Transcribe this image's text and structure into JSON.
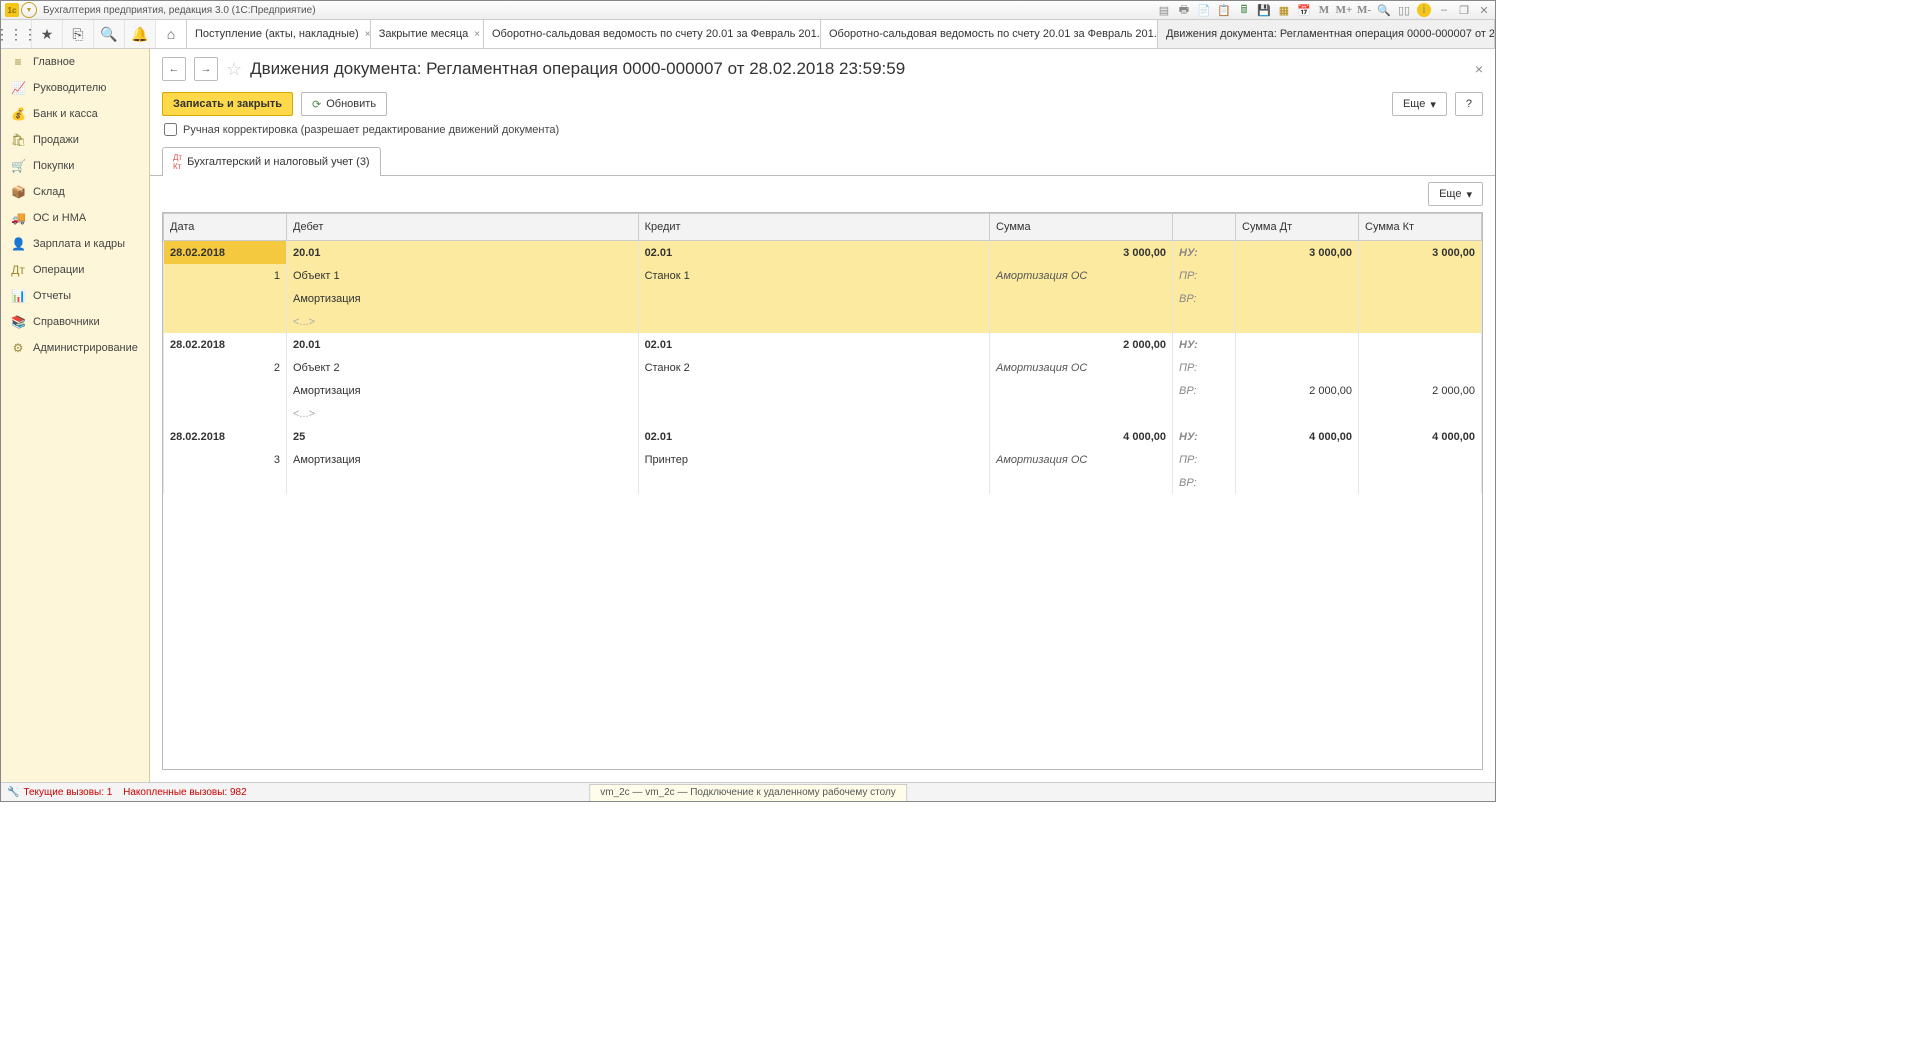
{
  "title": "Бухгалтерия предприятия, редакция 3.0  (1С:Предприятие)",
  "topTools": [
    "☰",
    "★",
    "⎘",
    "🔍",
    "🔔"
  ],
  "tabs": [
    {
      "label": "Поступление (акты, накладные)"
    },
    {
      "label": "Закрытие месяца"
    },
    {
      "label": "Оборотно-сальдовая ведомость по счету 20.01 за Февраль 201..."
    },
    {
      "label": "Оборотно-сальдовая ведомость по счету 20.01 за Февраль 201..."
    },
    {
      "label": "Движения документа: Регламентная операция 0000-000007 от 2...",
      "active": true
    }
  ],
  "sidebar": [
    {
      "ico": "≡",
      "label": "Главное"
    },
    {
      "ico": "📈",
      "label": "Руководителю"
    },
    {
      "ico": "💰",
      "label": "Банк и касса"
    },
    {
      "ico": "🛍",
      "label": "Продажи"
    },
    {
      "ico": "🛒",
      "label": "Покупки"
    },
    {
      "ico": "📦",
      "label": "Склад"
    },
    {
      "ico": "🚚",
      "label": "ОС и НМА"
    },
    {
      "ico": "👤",
      "label": "Зарплата и кадры"
    },
    {
      "ico": "Дт",
      "label": "Операции"
    },
    {
      "ico": "📊",
      "label": "Отчеты"
    },
    {
      "ico": "📚",
      "label": "Справочники"
    },
    {
      "ico": "⚙",
      "label": "Администрирование"
    }
  ],
  "pageTitle": "Движения документа: Регламентная операция 0000-000007 от 28.02.2018 23:59:59",
  "buttons": {
    "save": "Записать и закрыть",
    "refresh": "Обновить",
    "more": "Еще",
    "help": "?"
  },
  "checkbox": "Ручная корректировка (разрешает редактирование движений документа)",
  "subtab": "Бухгалтерский и налоговый учет (3)",
  "columns": {
    "date": "Дата",
    "debit": "Дебет",
    "credit": "Кредит",
    "sum": "Сумма",
    "sumDt": "Сумма Дт",
    "sumKt": "Сумма Кт"
  },
  "labels": {
    "nu": "НУ:",
    "pr": "ПР:",
    "vr": "ВР:",
    "placeholder": "<...>"
  },
  "rows": [
    {
      "sel": true,
      "n": "1",
      "date": "28.02.2018",
      "debit": "20.01",
      "credit": "02.01",
      "sum": "3 000,00",
      "sumDt": "3 000,00",
      "sumKt": "3 000,00",
      "l2d": "Объект 1",
      "l2c": "Станок 1",
      "l2s": "Амортизация ОС",
      "l3d": "Амортизация",
      "vrDt": "",
      "vrKt": ""
    },
    {
      "n": "2",
      "date": "28.02.2018",
      "debit": "20.01",
      "credit": "02.01",
      "sum": "2 000,00",
      "sumDt": "",
      "sumKt": "",
      "l2d": "Объект 2",
      "l2c": "Станок 2",
      "l2s": "Амортизация ОС",
      "l3d": "Амортизация",
      "vrDt": "2 000,00",
      "vrKt": "2 000,00"
    },
    {
      "n": "3",
      "date": "28.02.2018",
      "debit": "25",
      "credit": "02.01",
      "sum": "4 000,00",
      "sumDt": "4 000,00",
      "sumKt": "4 000,00",
      "l2d": "Амортизация",
      "l2c": "Принтер",
      "l2s": "Амортизация ОС",
      "l3d": "",
      "vrDt": "",
      "vrKt": "",
      "noPlaceholder": true
    }
  ],
  "status": {
    "current": "Текущие вызовы: 1",
    "accum": "Накопленные вызовы: 982"
  },
  "rdp": "vm_2c — vm_2c — Подключение к удаленному\nрабочему столу"
}
